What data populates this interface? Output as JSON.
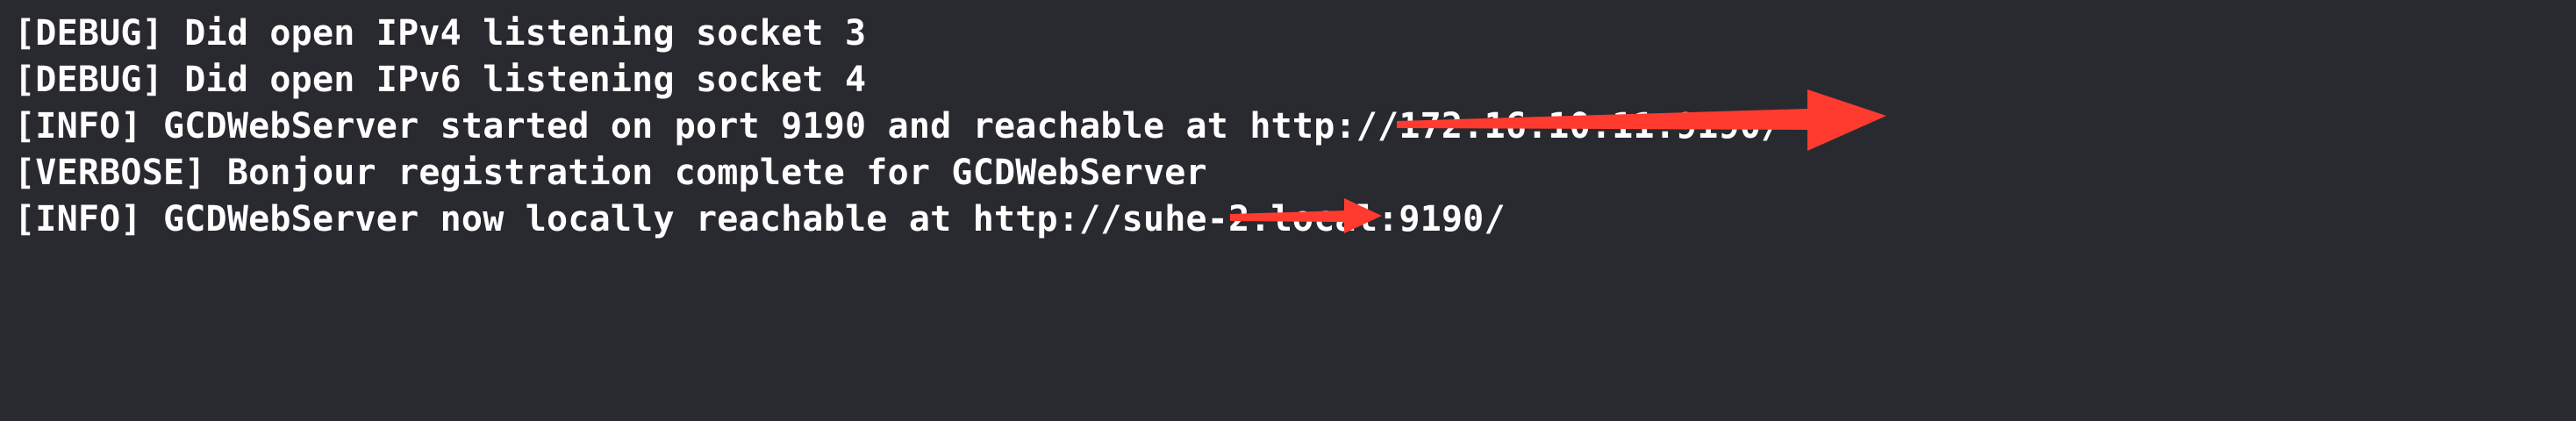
{
  "console": {
    "lines": [
      "[DEBUG] Did open IPv4 listening socket 3",
      "[DEBUG] Did open IPv6 listening socket 4",
      "[INFO] GCDWebServer started on port 9190 and reachable at http://172.16.10.11:9190/",
      "[VERBOSE] Bonjour registration complete for GCDWebServer",
      "[INFO] GCDWebServer now locally reachable at http://suhe-2.local:9190/"
    ]
  },
  "colors": {
    "background": "#292a30",
    "text": "#ffffff",
    "redaction_arrow": "#ff3b30"
  },
  "icons": {
    "redaction_mark": "red-arrow-icon"
  }
}
